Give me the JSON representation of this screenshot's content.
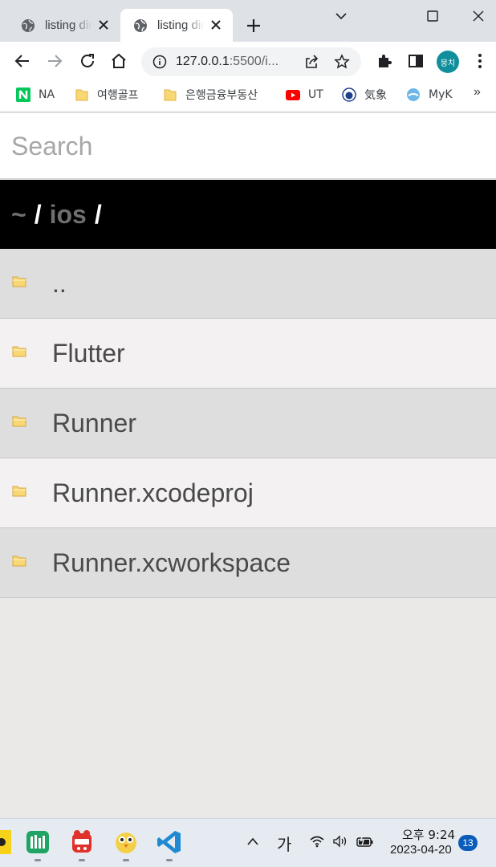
{
  "browser": {
    "tabs": [
      {
        "title": "listing directory",
        "active": false
      },
      {
        "title": "listing directory",
        "active": true
      }
    ],
    "address": {
      "host": "127.0.0.1",
      "rest": ":5500/i..."
    },
    "profile_initials": "뭉치",
    "bookmarks": [
      {
        "label": "NA",
        "icon": "naver-icon"
      },
      {
        "label": "여행골프",
        "icon": "folder-icon"
      },
      {
        "label": "은행금융부동산",
        "icon": "folder-icon"
      },
      {
        "label": "UT",
        "icon": "youtube-icon"
      },
      {
        "label": "気象",
        "icon": "weather-icon"
      },
      {
        "label": "MyK",
        "icon": "cloud-icon"
      }
    ],
    "bookmarks_more": "»"
  },
  "page": {
    "search_placeholder": "Search",
    "breadcrumb": {
      "home": "~",
      "sep": "/",
      "current": "ios",
      "sep_end": "/"
    },
    "entries": [
      {
        "name": ".."
      },
      {
        "name": "Flutter"
      },
      {
        "name": "Runner"
      },
      {
        "name": "Runner.xcodeproj"
      },
      {
        "name": "Runner.xcworkspace"
      }
    ]
  },
  "taskbar": {
    "ime": "가",
    "time": "오후 9:24",
    "date": "2023-04-20",
    "notifications": "13"
  },
  "colors": {
    "breadcrumb_bg": "#000000",
    "row_odd": "#dedede",
    "row_even": "#f3f1f1",
    "folder_yellow": "#f5c542",
    "avatar": "#0f8f9c"
  }
}
